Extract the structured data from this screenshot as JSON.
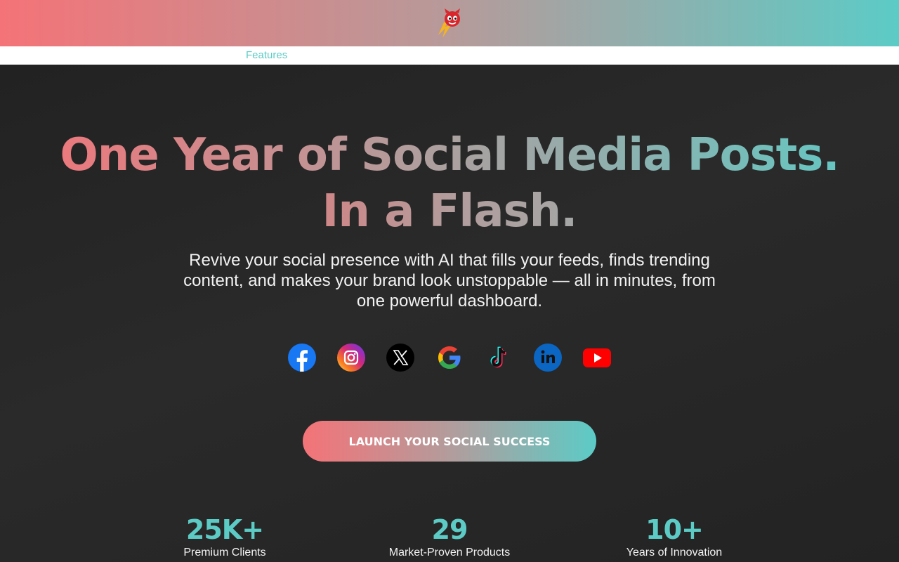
{
  "brand": {
    "gradient_start": "#f47378",
    "gradient_end": "#5ccbc6",
    "logo_icon": "lightning-devil-mascot-icon"
  },
  "nav": {
    "features_label": "Features"
  },
  "hero": {
    "headline_line1": "One Year of Social Media Posts.",
    "headline_line2": "In a Flash.",
    "subtitle": "Revive your social presence with AI that fills your feeds, finds trending content, and makes your brand look unstoppable — all in minutes, from one powerful dashboard.",
    "cta_label": "LAUNCH YOUR SOCIAL SUCCESS"
  },
  "socials": [
    {
      "icon": "facebook-icon",
      "color": "#1877f2"
    },
    {
      "icon": "instagram-icon",
      "color": "#e1306c"
    },
    {
      "icon": "x-icon",
      "color": "#000000"
    },
    {
      "icon": "google-icon",
      "color": "#4285f4"
    },
    {
      "icon": "tiktok-icon",
      "color": "#000000"
    },
    {
      "icon": "linkedin-icon",
      "color": "#0a66c2"
    },
    {
      "icon": "youtube-icon",
      "color": "#ff0000"
    }
  ],
  "stats": [
    {
      "value": "25K+",
      "label": "Premium Clients"
    },
    {
      "value": "29",
      "label": "Market-Proven Products"
    },
    {
      "value": "10+",
      "label": "Years of Innovation"
    }
  ]
}
